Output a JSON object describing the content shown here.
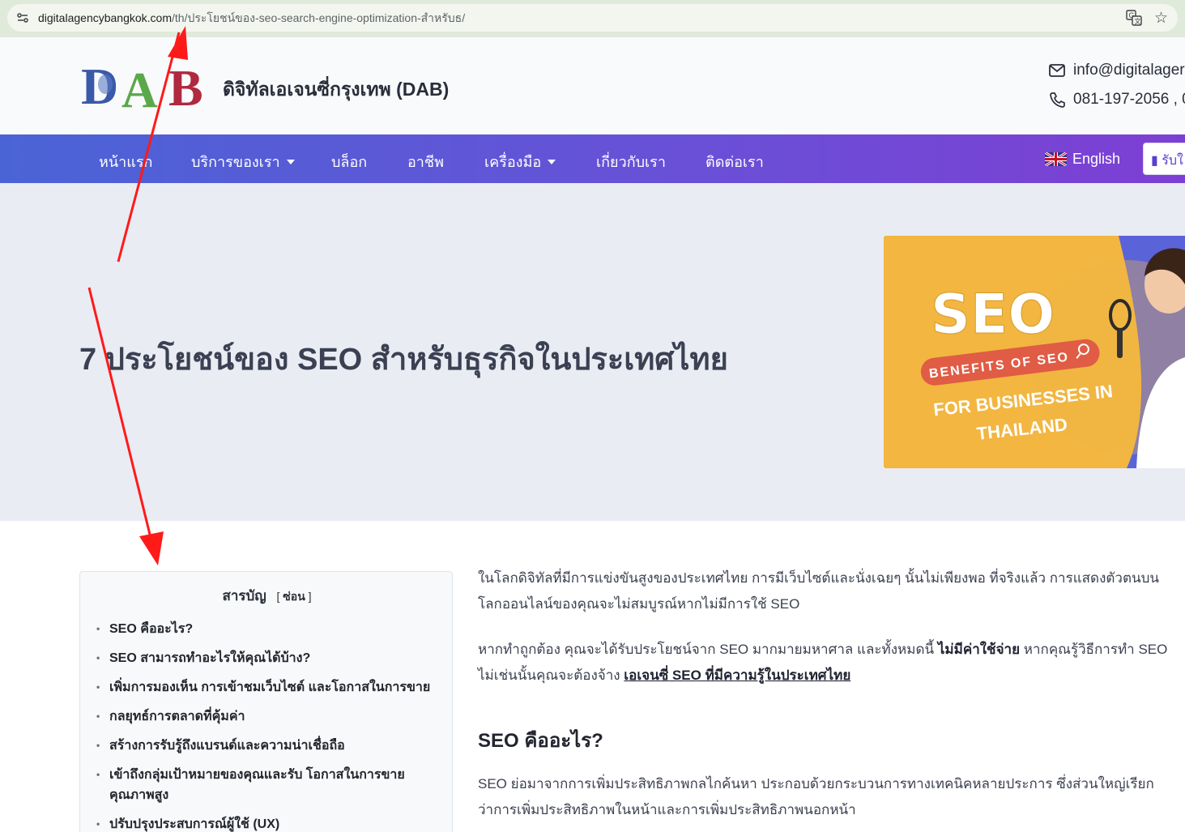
{
  "browser": {
    "url_host": "digitalagencybangkok.com",
    "url_path": "/th/ประโยชน์ของ-seo-search-engine-optimization-สำหรับธ/",
    "site_info_icon": "tune-icon",
    "translate_icon": "translate-icon",
    "bookmark_icon": "star-icon"
  },
  "header": {
    "logo_text": "DAB",
    "brand_name": "ดิจิทัลเอเจนซี่กรุงเทพ (DAB)",
    "email": "info@digitalager",
    "phone": "081-197-2056 , 0"
  },
  "nav": {
    "items": [
      {
        "label": "หน้าแรก",
        "dropdown": false
      },
      {
        "label": "บริการของเรา",
        "dropdown": true
      },
      {
        "label": "บล็อก",
        "dropdown": false
      },
      {
        "label": "อาชีพ",
        "dropdown": false
      },
      {
        "label": "เครื่องมือ",
        "dropdown": true
      },
      {
        "label": "เกี่ยวกับเรา",
        "dropdown": false
      },
      {
        "label": "ติดต่อเรา",
        "dropdown": false
      }
    ],
    "language": "English",
    "quote_button": "รับใ"
  },
  "hero": {
    "title": "7 ประโยชน์ของ SEO สำหรับธุรกิจในประเทศไทย",
    "image": {
      "big_word": "SEO",
      "ribbon": "BENEFITS OF SEO",
      "line1": "FOR BUSINESSES IN",
      "line2": "THAILAND"
    }
  },
  "toc": {
    "title": "สารบัญ",
    "toggle_open": "[",
    "toggle_label": "ซ่อน",
    "toggle_close": "]",
    "items": [
      "SEO คืออะไร?",
      "SEO สามารถทำอะไรให้คุณได้บ้าง?",
      "เพิ่มการมองเห็น การเข้าชมเว็บไซต์ และโอกาสในการขาย",
      "กลยุทธ์การตลาดที่คุ้มค่า",
      "สร้างการรับรู้ถึงแบรนด์และความน่าเชื่อถือ",
      "เข้าถึงกลุ่มเป้าหมายของคุณและรับ โอกาสในการขายคุณภาพสูง",
      "ปรับปรุงประสบการณ์ผู้ใช้ (UX)"
    ]
  },
  "article": {
    "p1": "ในโลกดิจิทัลที่มีการแข่งขันสูงของประเทศไทย การมีเว็บไซต์และนั่งเฉยๆ นั้นไม่เพียงพอ ที่จริงแล้ว การแสดงตัวตนบนโลกออนไลน์ของคุณจะไม่สมบูรณ์หากไม่มีการใช้ SEO",
    "p2_a": "หากทำถูกต้อง คุณจะได้รับประโยชน์จาก SEO มากมายมหาศาล และทั้งหมดนี้ ",
    "p2_bold": "ไม่มีค่าใช้จ่าย",
    "p2_b": " หากคุณรู้วิธีการทำ SEO ไม่เช่นนั้นคุณจะต้องจ้าง ",
    "p2_link": "เอเจนซี่ SEO ที่มีความรู้ในประเทศไทย",
    "h2": "SEO คืออะไร?",
    "p3": "SEO ย่อมาจากการเพิ่มประสิทธิภาพกลไกค้นหา ประกอบด้วยกระบวนการทางเทคนิคหลายประการ ซึ่งส่วนใหญ่เรียกว่าการเพิ่มประสิทธิภาพในหน้าและการเพิ่มประสิทธิภาพนอกหน้า"
  },
  "colors": {
    "nav_start": "#4a64d6",
    "nav_end": "#7d3fd3",
    "hero_bg": "#e9ecf3",
    "banner_yellow": "#f2b641",
    "ribbon": "#e05c45",
    "annotation_arrow": "#ff1a1a"
  }
}
